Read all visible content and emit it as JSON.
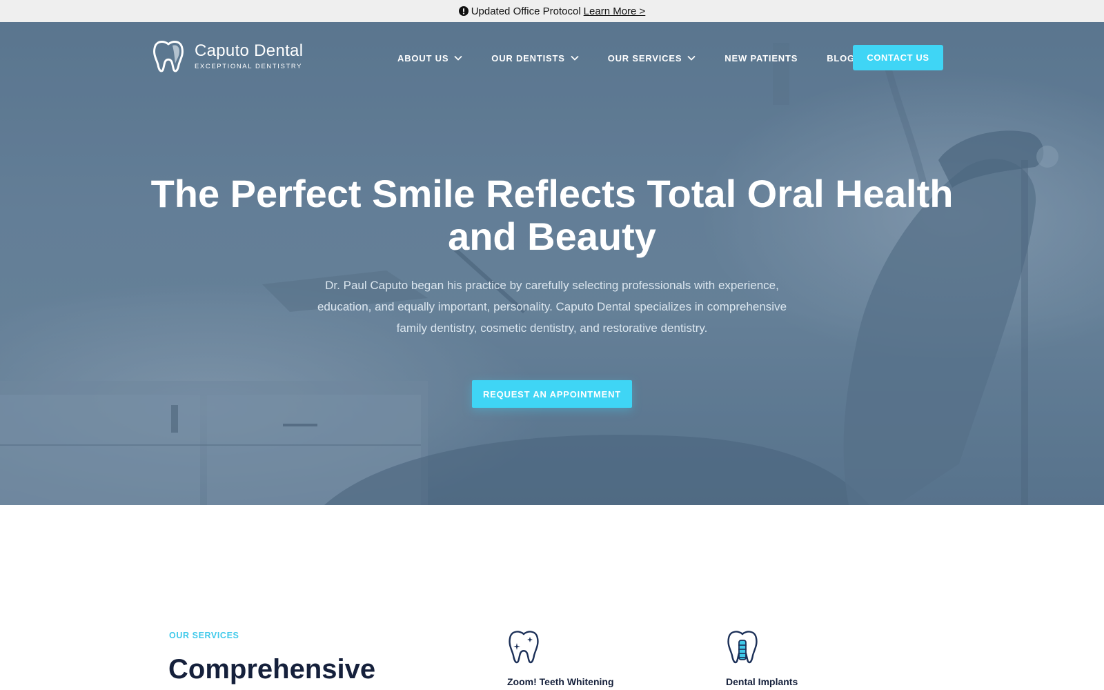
{
  "announcement": {
    "text": "Updated Office Protocol",
    "link_label": "Learn More >",
    "icon": "alert-circle-icon"
  },
  "header": {
    "logo_name": "Caputo Dental",
    "logo_tagline": "EXCEPTIONAL DENTISTRY",
    "logo_icon": "tooth-icon",
    "nav": [
      {
        "label": "ABOUT US",
        "dropdown": true
      },
      {
        "label": "OUR DENTISTS",
        "dropdown": true
      },
      {
        "label": "OUR SERVICES",
        "dropdown": true
      },
      {
        "label": "NEW PATIENTS",
        "dropdown": false
      },
      {
        "label": "BLOG",
        "dropdown": false
      }
    ],
    "contact_label": "CONTACT US"
  },
  "hero": {
    "title": "The Perfect Smile Reflects Total Oral Health and Beauty",
    "description": "Dr. Paul Caputo began his practice by carefully selecting professionals with experience, education, and equally important, personality. Caputo Dental specializes in comprehensive family dentistry, cosmetic dentistry, and restorative dentistry.",
    "cta_label": "REQUEST AN APPOINTMENT"
  },
  "services": {
    "eyebrow": "OUR SERVICES",
    "heading": "Comprehensive",
    "items": [
      {
        "label": "Zoom! Teeth Whitening",
        "icon": "sparkling-tooth-icon"
      },
      {
        "label": "Dental Implants",
        "icon": "tooth-implant-icon"
      }
    ]
  },
  "colors": {
    "accent": "#3fd5f5",
    "heading_navy": "#15203b",
    "hero_overlay": "#5f7a92"
  }
}
